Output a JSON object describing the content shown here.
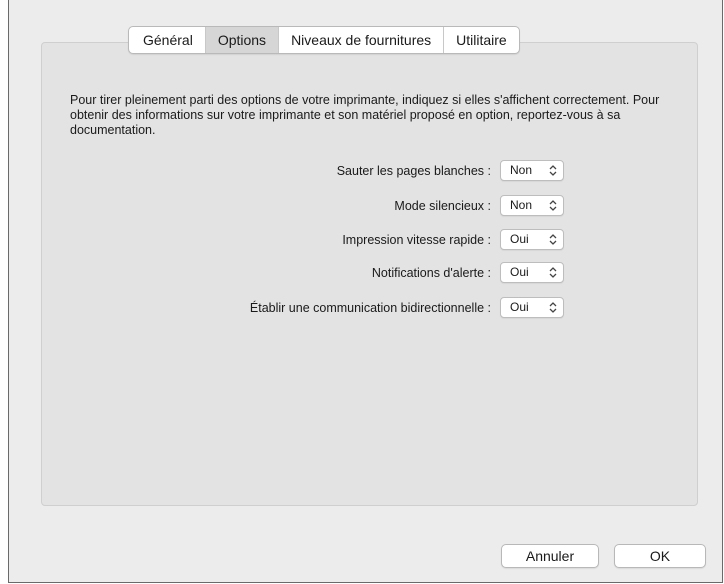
{
  "tabs": [
    {
      "label": "Général",
      "active": false
    },
    {
      "label": "Options",
      "active": true
    },
    {
      "label": "Niveaux de fournitures",
      "active": false
    },
    {
      "label": "Utilitaire",
      "active": false
    }
  ],
  "description": "Pour tirer pleinement parti des options de votre imprimante, indiquez si elles s'affichent correctement. Pour obtenir des informations sur votre imprimante et son matériel proposé en option, reportez-vous à sa documentation.",
  "options": [
    {
      "label": "Sauter les pages blanches :",
      "value": "Non"
    },
    {
      "label": "Mode silencieux :",
      "value": "Non"
    },
    {
      "label": "Impression vitesse rapide :",
      "value": "Oui"
    },
    {
      "label": "Notifications d'alerte :",
      "value": "Oui"
    },
    {
      "label": "Établir une communication bidirectionnelle :",
      "value": "Oui"
    }
  ],
  "buttons": {
    "cancel_label": "Annuler",
    "ok_label": "OK"
  }
}
